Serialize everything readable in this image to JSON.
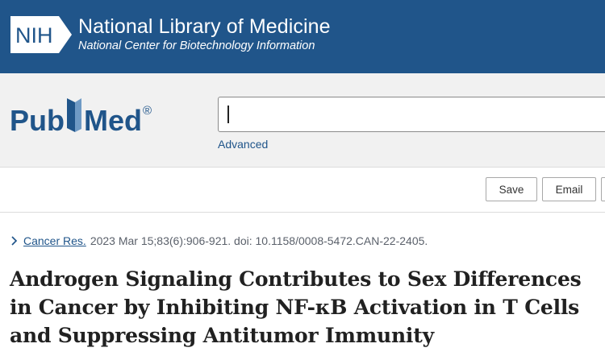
{
  "nih": {
    "logo_text": "NIH",
    "title": "National Library of Medicine",
    "subtitle": "National Center for Biotechnology Information"
  },
  "search": {
    "logo_text": "PubMed",
    "registered_mark": "®",
    "value": "",
    "advanced_label": "Advanced"
  },
  "actions": {
    "save_label": "Save",
    "email_label": "Email",
    "more_label": ""
  },
  "citation": {
    "journal": "Cancer Res.",
    "details": "2023 Mar 15;83(6):906-921. doi: 10.1158/0008-5472.CAN-22-2405."
  },
  "article": {
    "title": "Androgen Signaling Contributes to Sex Differences in Cancer by Inhibiting NF-κB Activation in T Cells and Suppressing Antitumor Immunity"
  },
  "colors": {
    "nih_blue": "#20558a",
    "pubmed_blue": "#20558a",
    "search_band": "#f1f1f1",
    "link": "#20558a"
  }
}
